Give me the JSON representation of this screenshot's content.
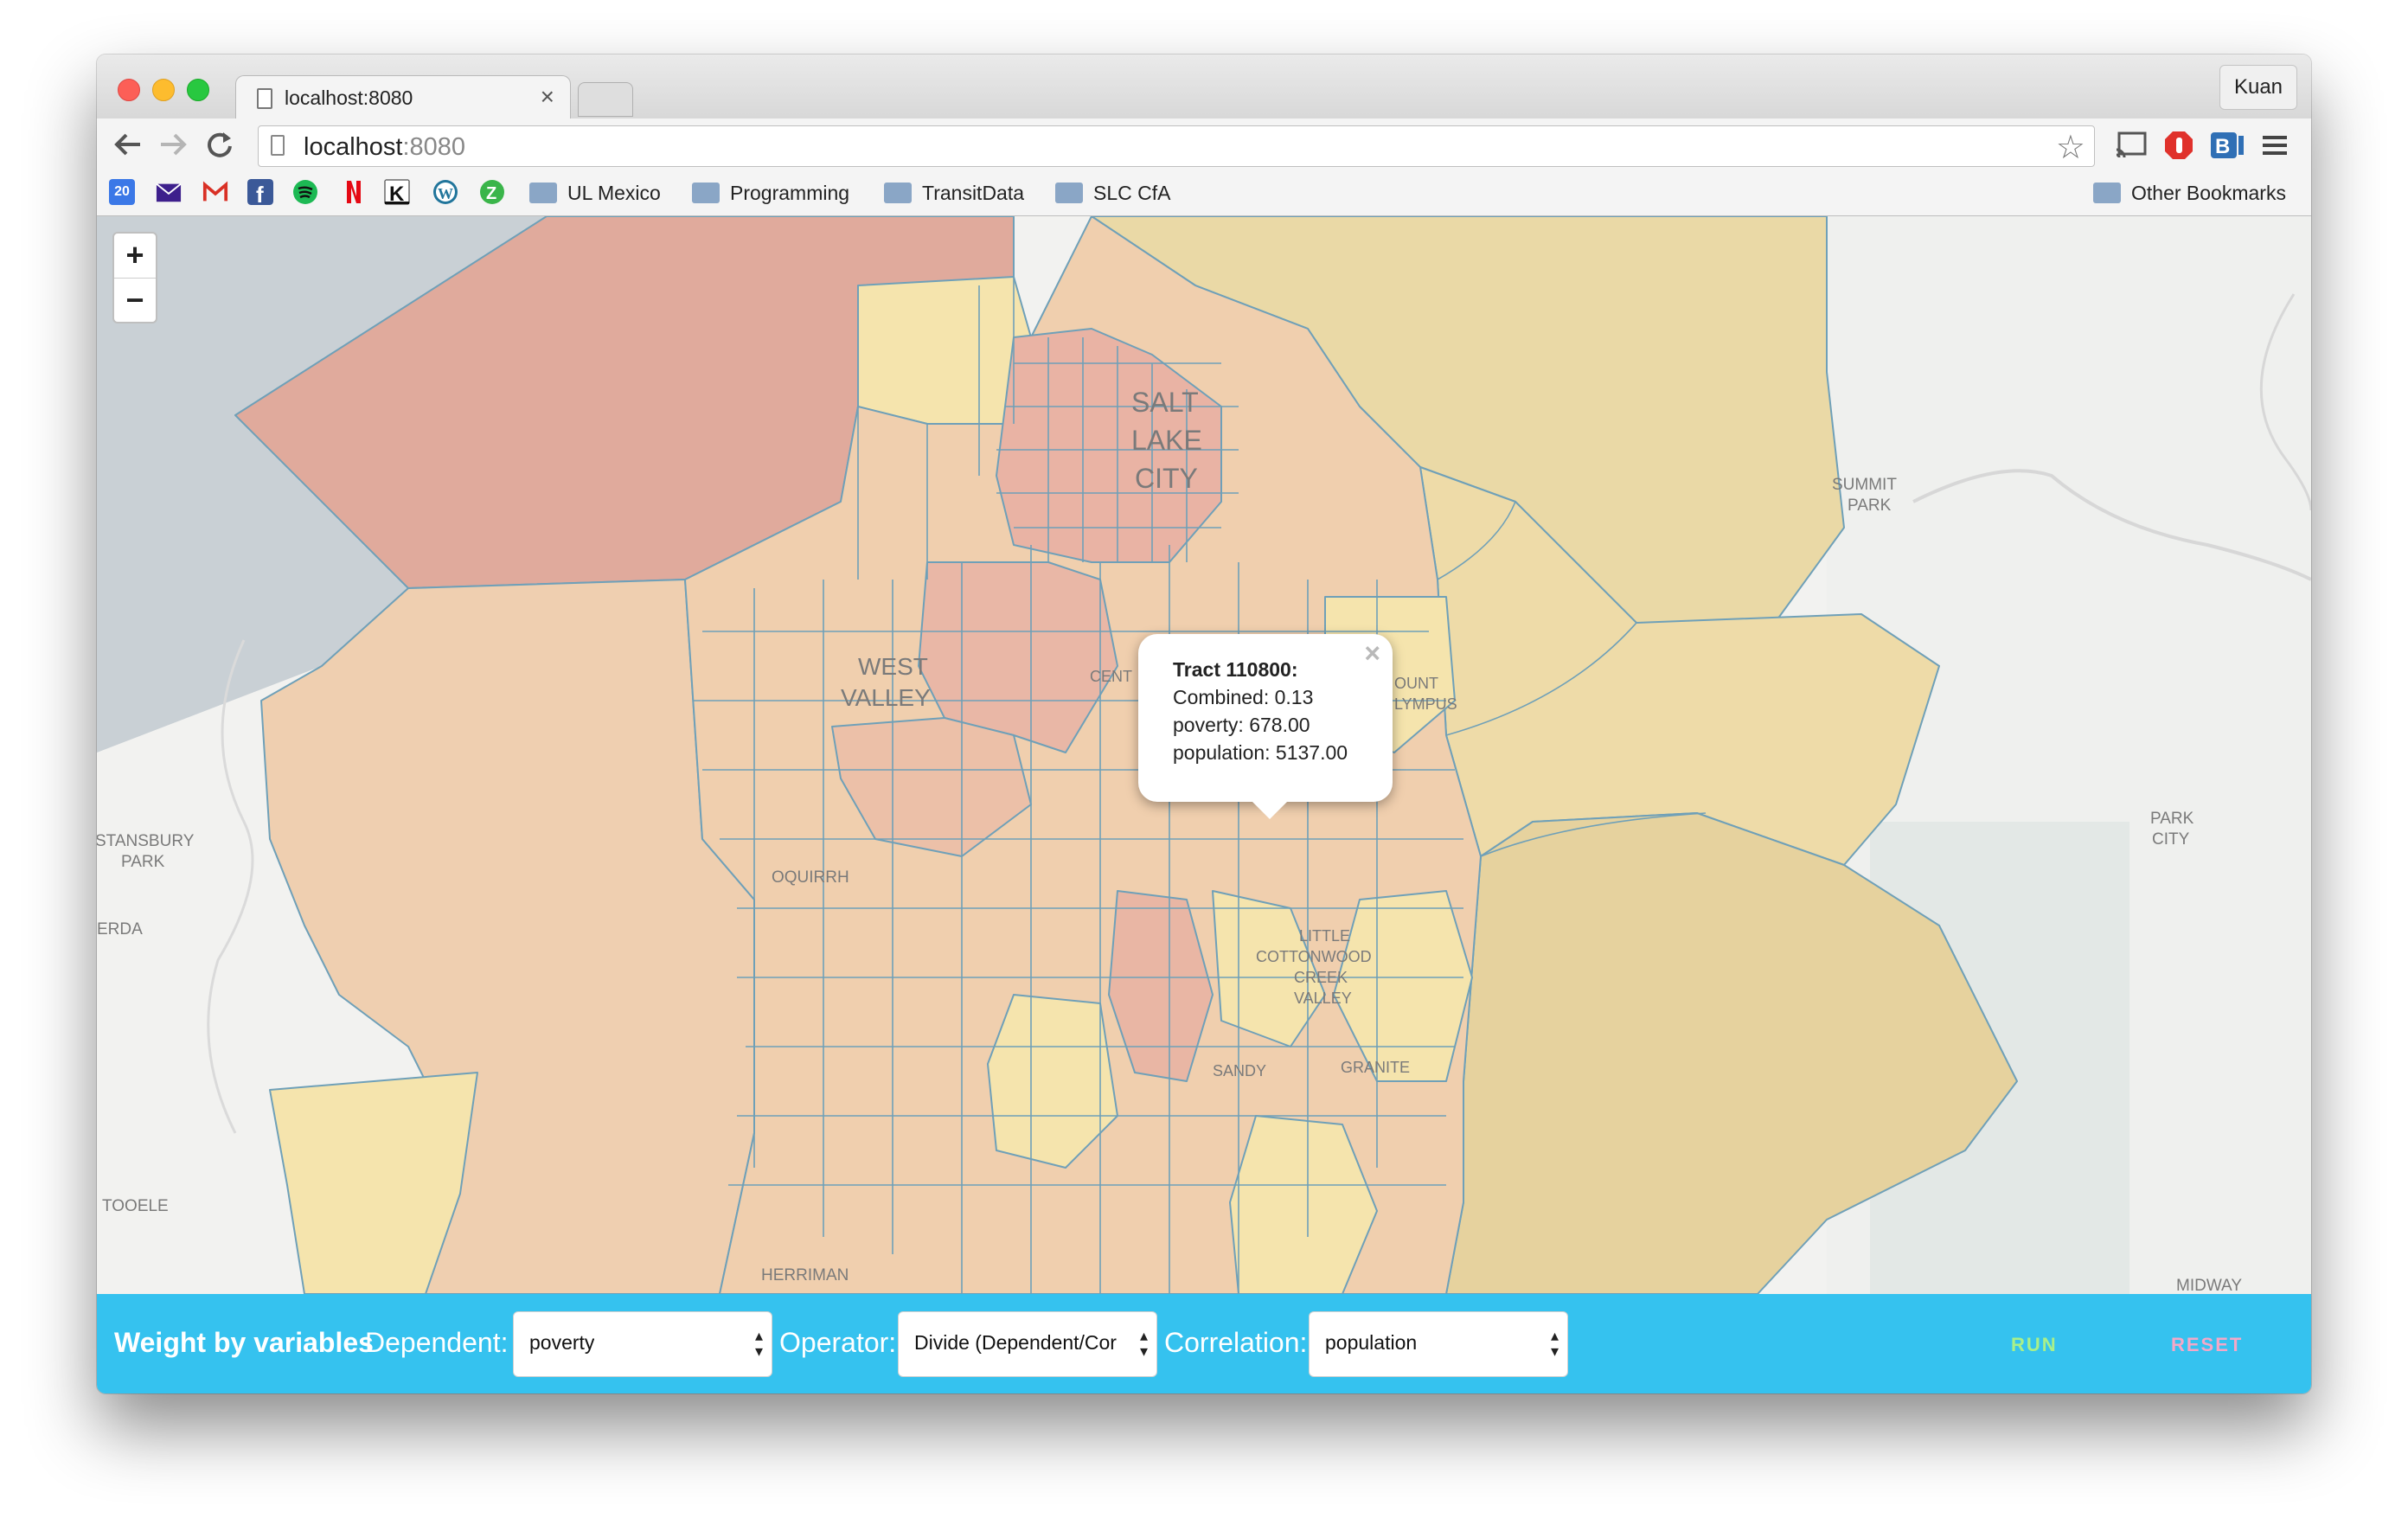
{
  "browser": {
    "tab_title": "localhost:8080",
    "tab_close": "×",
    "profile_name": "Kuan",
    "url_host": "localhost",
    "url_port": ":8080",
    "bookmark_calendar_day": "20",
    "bookmark_folders": [
      "UL Mexico",
      "Programming",
      "TransitData",
      "SLC CfA"
    ],
    "other_bookmarks": "Other Bookmarks"
  },
  "map": {
    "zoom_in": "+",
    "zoom_out": "−",
    "place_labels": {
      "salt": "SALT",
      "lake": "LAKE",
      "city": "CITY",
      "west": "WEST",
      "valley": "VALLEY",
      "summit": "SUMMIT",
      "park": "PARK",
      "park_city_1": "PARK",
      "park_city_2": "CITY",
      "stansbury_1": "STANSBURY",
      "stansbury_2": "PARK",
      "erda": "ERDA",
      "oquirrh": "OQUIRRH",
      "little": "LITTLE",
      "cottonwood": "COTTONWOOD",
      "creek": "CREEK",
      "valley2": "VALLEY",
      "sandy": "SANDY",
      "granite": "GRANITE",
      "tooele": "TOOELE",
      "herriman": "HERRIMAN",
      "midway": "MIDWAY",
      "olympus_1": "OUNT",
      "olympus_2": "LYMPUS",
      "central": "CENT"
    },
    "popup": {
      "title": "Tract 110800:",
      "combined": "Combined: 0.13",
      "poverty": "poverty: 678.00",
      "population": "population: 5137.00",
      "close": "×"
    },
    "colors": {
      "water": "#c9d0d5",
      "high": "#e8b0a8",
      "mid": "#efcfb0",
      "low": "#f5e4ad",
      "mountain": "#ead9a6",
      "boundary": "#6fa0b8"
    }
  },
  "controls": {
    "title": "Weight by variables",
    "dependent_label": "Dependent:",
    "dependent_value": "poverty",
    "operator_label": "Operator:",
    "operator_value": "Divide (Dependent/Cor",
    "correlation_label": "Correlation:",
    "correlation_value": "population",
    "run": "RUN",
    "reset": "RESET",
    "run_color": "#a8f08a",
    "reset_color": "#f4a8c8",
    "bar_color": "#35c2ef"
  }
}
